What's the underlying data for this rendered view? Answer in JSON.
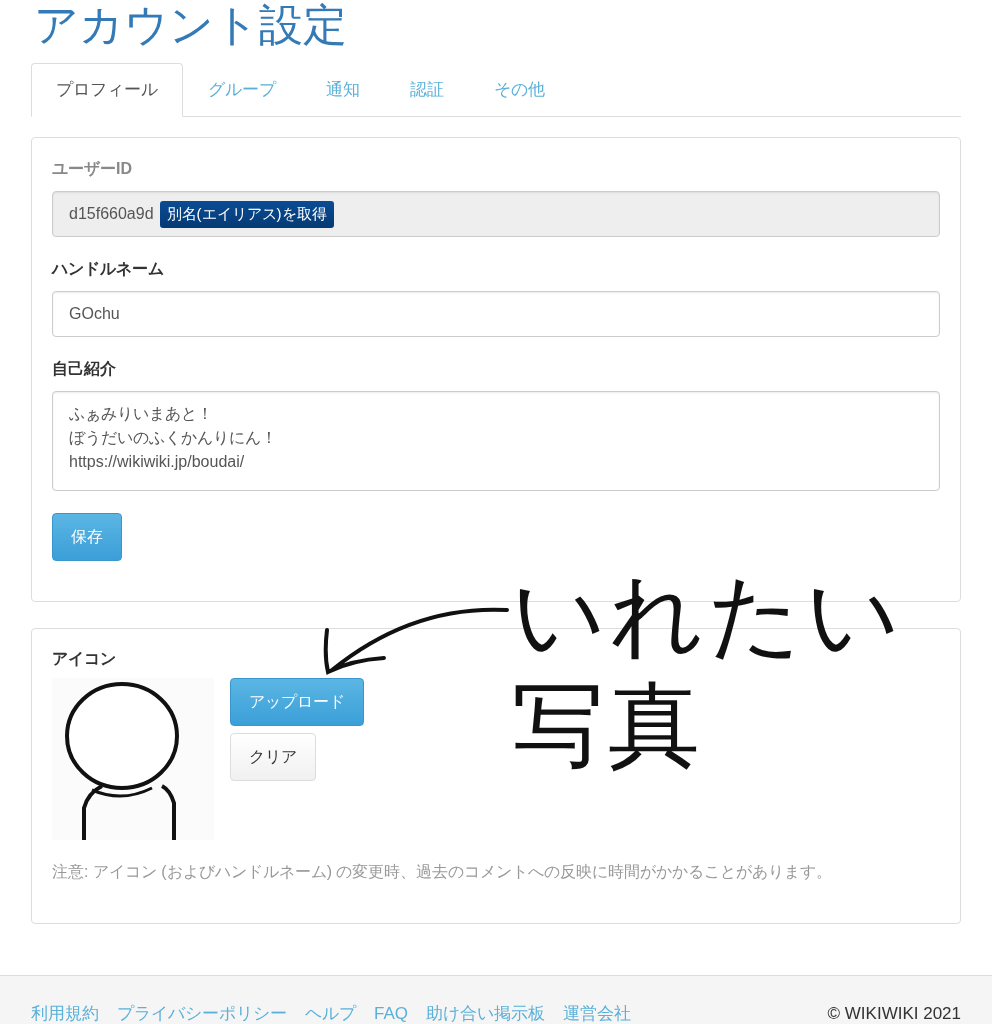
{
  "page": {
    "title": "アカウント設定"
  },
  "tabs": [
    {
      "label": "プロフィール",
      "selected": true
    },
    {
      "label": "グループ",
      "selected": false
    },
    {
      "label": "通知",
      "selected": false
    },
    {
      "label": "認証",
      "selected": false
    },
    {
      "label": "その他",
      "selected": false
    }
  ],
  "profile": {
    "user_id": {
      "label": "ユーザーID",
      "value": "d15f660a9d",
      "alias_button": "別名(エイリアス)を取得"
    },
    "handle": {
      "label": "ハンドルネーム",
      "value": "GOchu"
    },
    "bio": {
      "label": "自己紹介",
      "lines": [
        "ふぁみりいまあと！",
        "ぼうだいのふくかんりにん！",
        "https://wikiwiki.jp/boudai/"
      ]
    },
    "save_button": "保存"
  },
  "icon_section": {
    "label": "アイコン",
    "upload_button": "アップロード",
    "clear_button": "クリア",
    "note": "注意: アイコン (およびハンドルネーム) の変更時、過去のコメントへの反映に時間がかかることがあります。"
  },
  "annotation": {
    "lines": [
      "いれたい",
      "写真"
    ]
  },
  "footer": {
    "links": [
      "利用規約",
      "プライバシーポリシー",
      "ヘルプ",
      "FAQ",
      "助け合い掲示板",
      "運営会社"
    ],
    "copyright": "© WIKIWIKI 2021"
  }
}
